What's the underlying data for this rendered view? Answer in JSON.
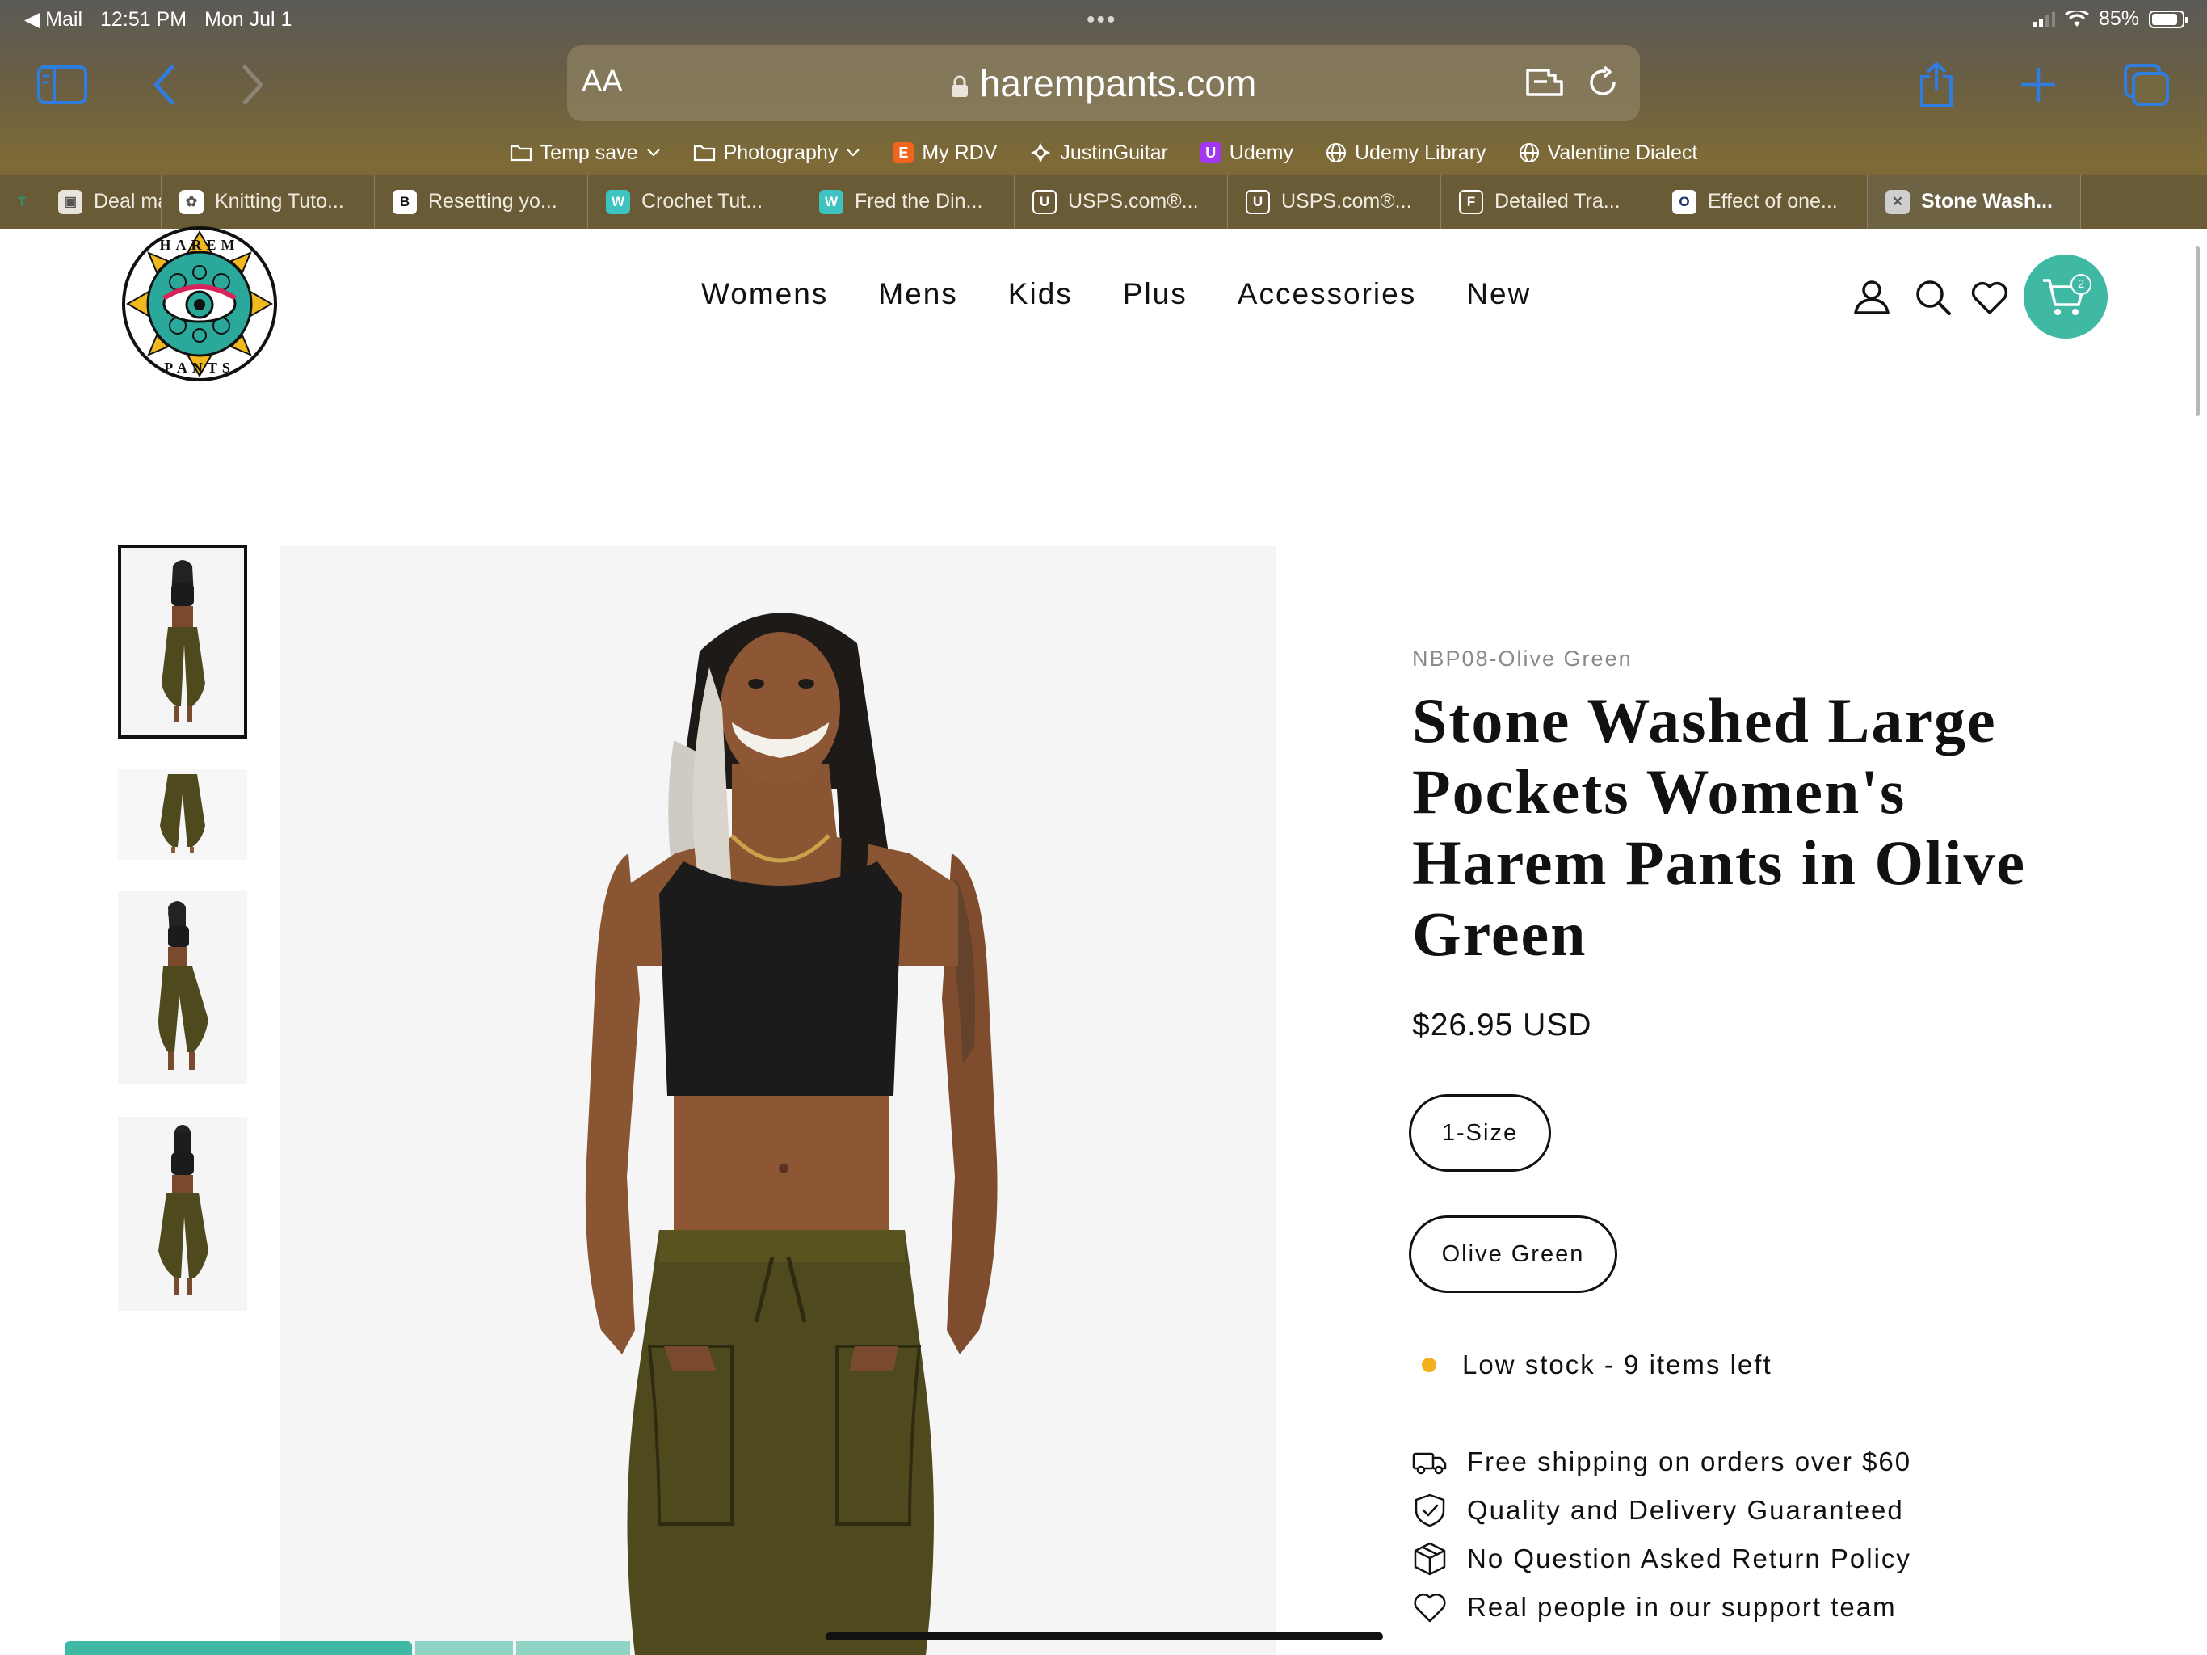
{
  "status_bar": {
    "back_app": "◀ Mail",
    "time": "12:51 PM",
    "date": "Mon Jul 1",
    "battery": "85%",
    "battery_level": 0.85
  },
  "browser": {
    "reader_label": "AA",
    "url": "harempants.com",
    "favorites": [
      {
        "label": "Temp save",
        "icon": "folder-icon",
        "dropdown": true
      },
      {
        "label": "Photography",
        "icon": "folder-icon",
        "dropdown": true
      },
      {
        "label": "My RDV",
        "icon": "etsy-icon",
        "glyph": "E",
        "color": "#f1641e"
      },
      {
        "label": "JustinGuitar",
        "icon": "justinguitar-icon"
      },
      {
        "label": "Udemy",
        "icon": "udemy-icon",
        "glyph": "U",
        "color": "#a435f0"
      },
      {
        "label": "Udemy Library",
        "icon": "globe-icon"
      },
      {
        "label": "Valentine Dialect",
        "icon": "globe-icon"
      }
    ],
    "tabs": [
      {
        "label": "",
        "glyph": "T",
        "icon": "nyt-icon",
        "color": "transparent",
        "fg": "#2f8f6b"
      },
      {
        "label": "Deal may b",
        "glyph": "▣",
        "icon": "article-thumb-icon",
        "color": "#e8e4dc",
        "fg": "#555"
      },
      {
        "label": "Knitting Tuto...",
        "glyph": "✿",
        "icon": "knitting-thumb-icon",
        "color": "#ffffff",
        "fg": "#555"
      },
      {
        "label": "Resetting yo...",
        "glyph": "B",
        "icon": "brand-b-icon",
        "color": "#ffffff",
        "fg": "#111"
      },
      {
        "label": "Crochet Tut...",
        "glyph": "W",
        "icon": "w-circle-icon",
        "color": "#3fc3c0",
        "fg": "#fff"
      },
      {
        "label": "Fred the Din...",
        "glyph": "W",
        "icon": "w-circle-icon",
        "color": "#3fc3c0",
        "fg": "#fff"
      },
      {
        "label": "USPS.com®...",
        "glyph": "U",
        "icon": "u-letter-icon",
        "color": "transparent",
        "fg": "#fff"
      },
      {
        "label": "USPS.com®...",
        "glyph": "U",
        "icon": "u-letter-icon",
        "color": "transparent",
        "fg": "#fff"
      },
      {
        "label": "Detailed Tra...",
        "glyph": "F",
        "icon": "f-letter-icon",
        "color": "transparent",
        "fg": "#fff"
      },
      {
        "label": "Effect of one...",
        "glyph": "O",
        "icon": "o-circle-icon",
        "color": "#ffffff",
        "fg": "#1a2b6b"
      },
      {
        "label": "Stone Wash...",
        "glyph": "✕",
        "icon": "close-tab-icon",
        "color": "#cfcfcf",
        "fg": "#555",
        "active": true
      }
    ]
  },
  "site": {
    "logo_text": "HAREM PANTS",
    "nav": [
      "Womens",
      "Mens",
      "Kids",
      "Plus",
      "Accessories",
      "New"
    ],
    "cart_count": "2",
    "accent": "#3fb8a4"
  },
  "product": {
    "sku": "NBP08-Olive Green",
    "title": "Stone Washed Large Pockets Women's Harem Pants in Olive Green",
    "price": "$26.95 USD",
    "size_option": "1-Size",
    "color_option": "Olive Green",
    "stock_text": "Low stock - 9 items left",
    "features": [
      {
        "icon": "truck-icon",
        "text": "Free shipping on orders over $60"
      },
      {
        "icon": "shield-check-icon",
        "text": "Quality and Delivery Guaranteed"
      },
      {
        "icon": "box-icon",
        "text": "No Question Asked Return Policy"
      },
      {
        "icon": "heart-icon",
        "text": "Real people in our support team"
      }
    ],
    "thumbnails": [
      "front-view",
      "pants-only",
      "side-pose",
      "back-view"
    ],
    "olive": "#4f4a1e",
    "top_color": "#1b1b1b"
  }
}
